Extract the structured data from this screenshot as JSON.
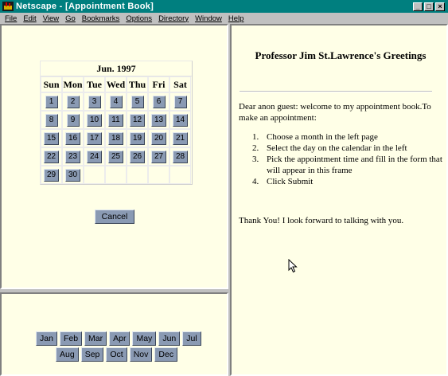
{
  "window": {
    "title": "Netscape - [Appointment Book]"
  },
  "menu": [
    "File",
    "Edit",
    "View",
    "Go",
    "Bookmarks",
    "Options",
    "Directory",
    "Window",
    "Help"
  ],
  "calendar": {
    "title": "Jun. 1997",
    "weekdays": [
      "Sun",
      "Mon",
      "Tue",
      "Wed",
      "Thu",
      "Fri",
      "Sat"
    ],
    "weeks": [
      [
        "1",
        "2",
        "3",
        "4",
        "5",
        "6",
        "7"
      ],
      [
        "8",
        "9",
        "10",
        "11",
        "12",
        "13",
        "14"
      ],
      [
        "15",
        "16",
        "17",
        "18",
        "19",
        "20",
        "21"
      ],
      [
        "22",
        "23",
        "24",
        "25",
        "26",
        "27",
        "28"
      ],
      [
        "29",
        "30",
        "",
        "",
        "",
        "",
        ""
      ]
    ],
    "cancel_label": "Cancel"
  },
  "months": {
    "row1": [
      "Jan",
      "Feb",
      "Mar",
      "Apr",
      "May",
      "Jun",
      "Jul"
    ],
    "row2": [
      "Aug",
      "Sep",
      "Oct",
      "Nov",
      "Dec"
    ]
  },
  "greeting": {
    "title": "Professor Jim St.Lawrence's Greetings",
    "intro": "Dear anon guest: welcome to my appointment book.To make an appointment:",
    "steps": [
      "Choose a month in the left page",
      "Select the day on the calendar in the left",
      "Pick the appointment time and fill in the form that will appear in this frame",
      "Click Submit"
    ],
    "thanks": "Thank You! I look forward to talking with you."
  }
}
